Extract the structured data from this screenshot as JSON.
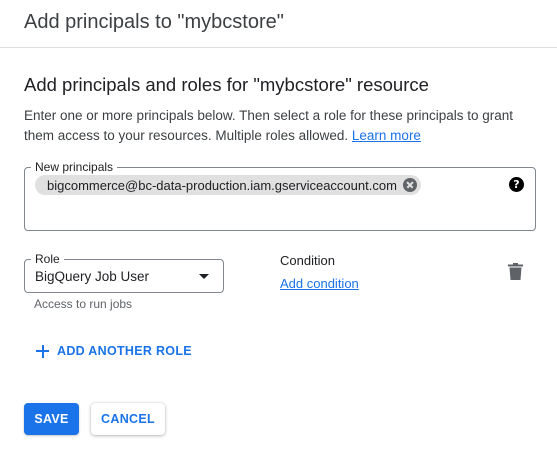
{
  "dialog": {
    "title": "Add principals to \"mybcstore\""
  },
  "section": {
    "title": "Add principals and roles for \"mybcstore\" resource",
    "description": "Enter one or more principals below. Then select a role for these principals to grant them access to your resources. Multiple roles allowed.",
    "learn_more": "Learn more"
  },
  "principals": {
    "label": "New principals",
    "chips": [
      {
        "text": "bigcommerce@bc-data-production.iam.gserviceaccount.com",
        "close_icon": "cancel-circle-icon"
      }
    ],
    "help_icon": "help-icon"
  },
  "role": {
    "label": "Role",
    "selected": "BigQuery Job User",
    "hint": "Access to run jobs",
    "dropdown_icon": "arrow-drop-down-icon"
  },
  "condition": {
    "label": "Condition",
    "add_link": "Add condition"
  },
  "delete_icon": "trash-icon",
  "add_another_role": {
    "label": "ADD ANOTHER ROLE",
    "icon": "plus-icon"
  },
  "actions": {
    "save": "SAVE",
    "cancel": "CANCEL"
  },
  "colors": {
    "accent": "#1a73e8",
    "text": "#202124",
    "muted": "#5f6368",
    "chip_bg": "#e0e0e0",
    "border": "#80868b"
  }
}
